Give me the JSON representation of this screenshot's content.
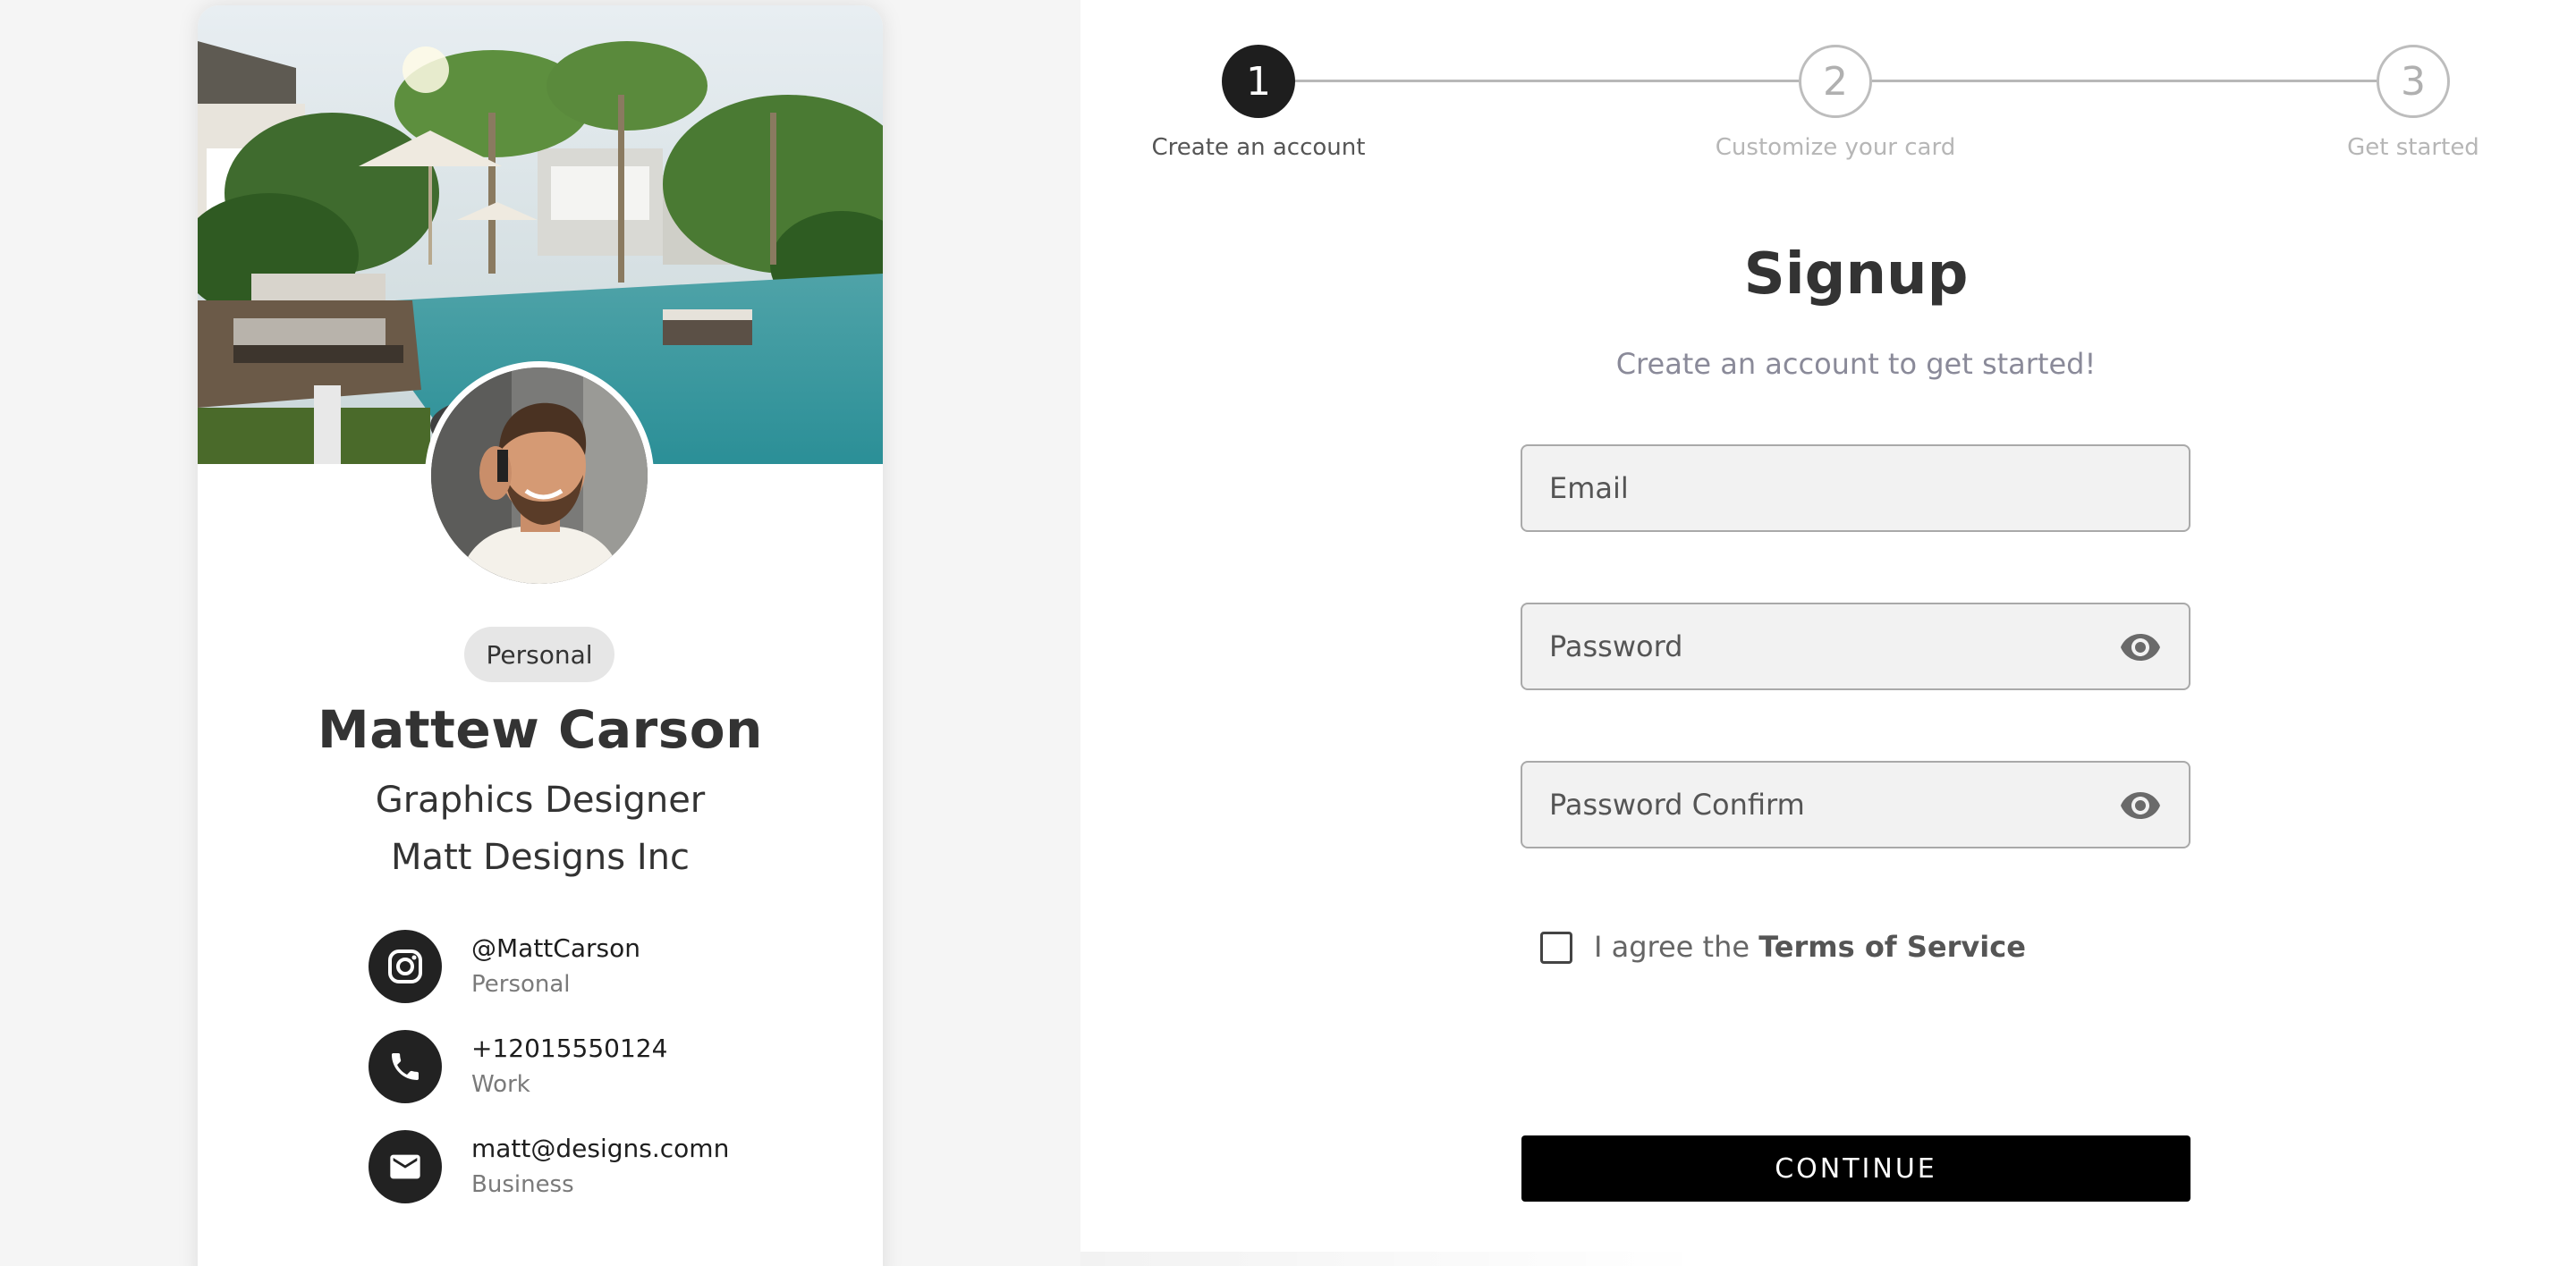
{
  "profile_card": {
    "cover_image": "tropical-resort-pool-photo",
    "avatar_image": "man-on-phone-portrait",
    "badge": "Personal",
    "name": "Mattew Carson",
    "job_title": "Graphics Designer",
    "company": "Matt Designs Inc",
    "contacts": [
      {
        "icon": "instagram-icon",
        "value": "@MattCarson",
        "label": "Personal"
      },
      {
        "icon": "phone-icon",
        "value": "+12015550124",
        "label": "Work"
      },
      {
        "icon": "email-icon",
        "value": "matt@designs.comn",
        "label": "Business"
      }
    ]
  },
  "stepper": {
    "current_step": 1,
    "steps": [
      {
        "number": "1",
        "label": "Create an account",
        "state": "active"
      },
      {
        "number": "2",
        "label": "Customize your card",
        "state": "inactive"
      },
      {
        "number": "3",
        "label": "Get started",
        "state": "inactive"
      }
    ]
  },
  "signup": {
    "title": "Signup",
    "subtitle": "Create an account to get started!",
    "email_placeholder": "Email",
    "password_placeholder": "Password",
    "password_confirm_placeholder": "Password Confirm",
    "agree_prefix": "I agree the ",
    "terms_link": "Terms of Service",
    "agree_checked": false,
    "continue_label": "CONTINUE"
  },
  "colors": {
    "accent": "#1e1e1e",
    "button_bg": "#000000",
    "left_panel_bg": "#f5f5f5"
  }
}
